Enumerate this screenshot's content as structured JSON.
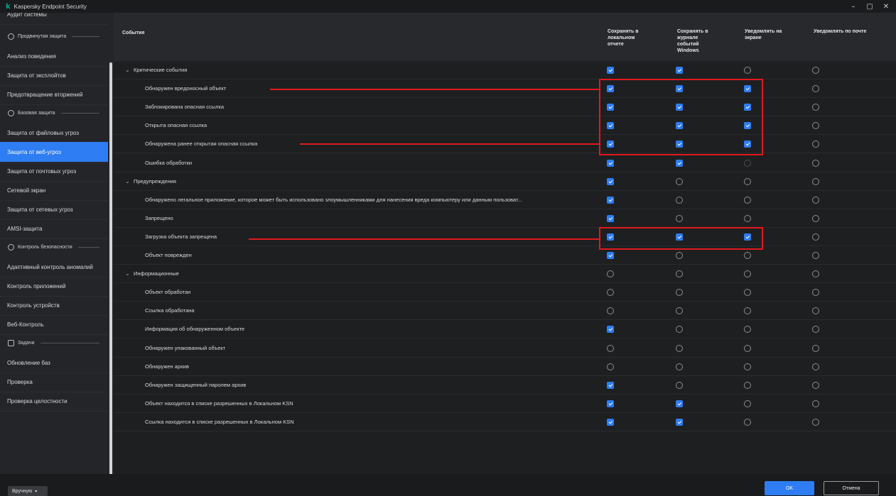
{
  "window": {
    "app_title": "Kaspersky Endpoint Security",
    "logo_glyph": "k",
    "controls": {
      "minimize": "–",
      "maximize": "▢",
      "close": "✕"
    }
  },
  "sidebar": {
    "items": [
      {
        "kind": "item",
        "label": "Аудит системы"
      },
      {
        "kind": "section",
        "label": "Продвинутая защита",
        "icon": "advanced-protection-icon"
      },
      {
        "kind": "item",
        "label": "Анализ поведения"
      },
      {
        "kind": "item",
        "label": "Защита от эксплойтов"
      },
      {
        "kind": "item",
        "label": "Предотвращение вторжений"
      },
      {
        "kind": "section",
        "label": "Базовая защита",
        "icon": "basic-protection-icon"
      },
      {
        "kind": "item",
        "label": "Защита от файловых угроз"
      },
      {
        "kind": "item",
        "label": "Защита от веб-угроз",
        "selected": true
      },
      {
        "kind": "item",
        "label": "Защита от почтовых угроз"
      },
      {
        "kind": "item",
        "label": "Сетевой экран"
      },
      {
        "kind": "item",
        "label": "Защита от сетевых угроз"
      },
      {
        "kind": "item",
        "label": "AMSI-защита"
      },
      {
        "kind": "section",
        "label": "Контроль безопасности",
        "icon": "security-control-icon"
      },
      {
        "kind": "item",
        "label": "Адаптивный контроль аномалий"
      },
      {
        "kind": "item",
        "label": "Контроль приложений"
      },
      {
        "kind": "item",
        "label": "Контроль устройств"
      },
      {
        "kind": "item",
        "label": "Веб-Контроль"
      },
      {
        "kind": "section",
        "label": "Задачи",
        "icon": "tasks-icon"
      },
      {
        "kind": "item",
        "label": "Обновление баз"
      },
      {
        "kind": "item",
        "label": "Проверка"
      },
      {
        "kind": "item",
        "label": "Проверка целостности"
      }
    ]
  },
  "table": {
    "columns": [
      "События",
      "Сохранять в локальном отчете",
      "Сохранять в журнале событий Windows",
      "Уведомлять на экране",
      "Уведомлять по почте"
    ],
    "rows": [
      {
        "type": "group",
        "label": "Критические события",
        "values": [
          "on",
          "on",
          "off",
          "off"
        ]
      },
      {
        "type": "event",
        "label": "Обнаружен вредоносный объект",
        "values": [
          "on",
          "on",
          "on",
          "off"
        ]
      },
      {
        "type": "event",
        "label": "Заблокирована опасная ссылка",
        "values": [
          "on",
          "on",
          "on",
          "off"
        ]
      },
      {
        "type": "event",
        "label": "Открыта опасная ссылка",
        "values": [
          "on",
          "on",
          "on",
          "off"
        ]
      },
      {
        "type": "event",
        "label": "Обнаружена ранее открытая опасная ссылка",
        "values": [
          "on",
          "on",
          "on",
          "off"
        ]
      },
      {
        "type": "event",
        "label": "Ошибка обработки",
        "values": [
          "on",
          "on",
          "dis",
          "off"
        ]
      },
      {
        "type": "group",
        "label": "Предупреждения",
        "values": [
          "on",
          "off",
          "off",
          "off"
        ]
      },
      {
        "type": "event",
        "label": "Обнаружено легальное приложение, которое может быть использовано злоумышленниками для нанесения вреда компьютеру или данным пользоват...",
        "values": [
          "on",
          "off",
          "off",
          "off"
        ]
      },
      {
        "type": "event",
        "label": "Запрещено",
        "values": [
          "on",
          "off",
          "off",
          "off"
        ]
      },
      {
        "type": "event",
        "label": "Загрузка объекта запрещена",
        "values": [
          "on",
          "on",
          "on",
          "off"
        ]
      },
      {
        "type": "event",
        "label": "Объект поврежден",
        "values": [
          "on",
          "off",
          "off",
          "off"
        ]
      },
      {
        "type": "group",
        "label": "Информационные",
        "values": [
          "off",
          "off",
          "off",
          "off"
        ]
      },
      {
        "type": "event",
        "label": "Объект обработан",
        "values": [
          "off",
          "off",
          "off",
          "off"
        ]
      },
      {
        "type": "event",
        "label": "Ссылка обработана",
        "values": [
          "off",
          "off",
          "off",
          "off"
        ]
      },
      {
        "type": "event",
        "label": "Информация об обнаруженном объекте",
        "values": [
          "on",
          "off",
          "off",
          "off"
        ]
      },
      {
        "type": "event",
        "label": "Обнаружен упакованный объект",
        "values": [
          "off",
          "off",
          "off",
          "off"
        ]
      },
      {
        "type": "event",
        "label": "Обнаружен архив",
        "values": [
          "off",
          "off",
          "off",
          "off"
        ]
      },
      {
        "type": "event",
        "label": "Обнаружен защищенный паролем архив",
        "values": [
          "on",
          "off",
          "off",
          "off"
        ]
      },
      {
        "type": "event",
        "label": "Объект находится в списке разрешенных в Локальном KSN",
        "values": [
          "on",
          "on",
          "off",
          "off"
        ]
      },
      {
        "type": "event",
        "label": "Ссылка находится в списке разрешенных в Локальном KSN",
        "values": [
          "on",
          "on",
          "off",
          "off"
        ]
      }
    ]
  },
  "footer": {
    "mode_select": "Вручную",
    "ok_label": "OK",
    "cancel_label": "Отмена"
  },
  "colors": {
    "accent": "#2e7df2",
    "highlight": "#e0191c",
    "brand": "#00a88e"
  }
}
